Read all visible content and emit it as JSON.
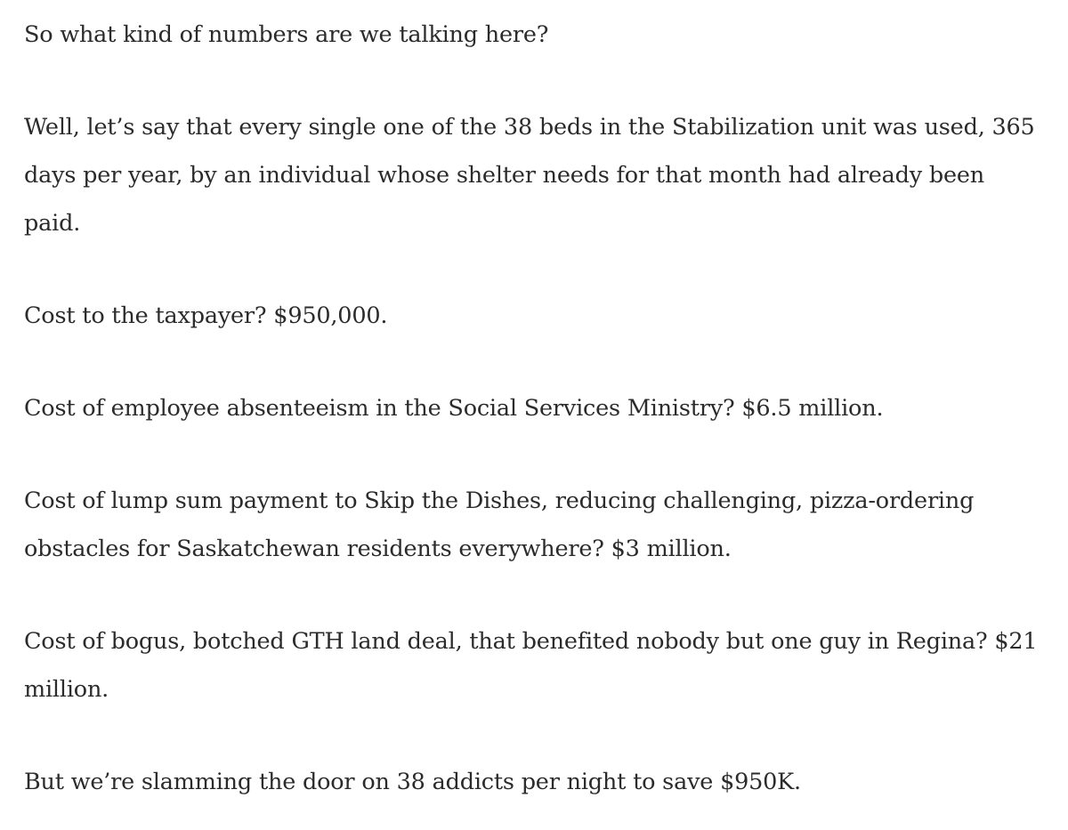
{
  "article": {
    "paragraphs": [
      "So what kind of numbers are we talking here?",
      "Well, let’s say that every single one of the 38 beds in the Stabilization unit was used, 365 days per year, by an individual whose shelter needs for that month had already been paid.",
      "Cost to the taxpayer? $950,000.",
      "Cost of employee absenteeism in the Social Services Ministry? $6.5 million.",
      "Cost of lump sum payment to Skip the Dishes, reducing challenging, pizza-ordering obstacles for Saskatchewan residents everywhere? $3 million.",
      "Cost of bogus, botched GTH land deal, that benefited nobody but one guy in Regina? $21 million.",
      "But we’re slamming the door on 38 addicts per night to save $950K."
    ]
  }
}
